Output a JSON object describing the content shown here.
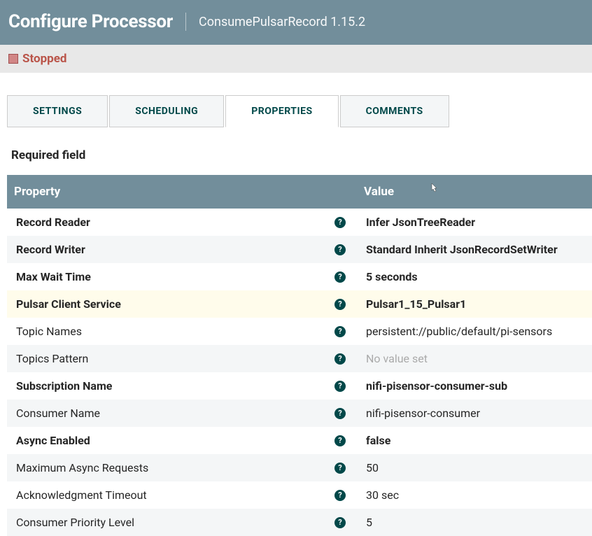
{
  "header": {
    "title": "Configure Processor",
    "subtitle": "ConsumePulsarRecord 1.15.2"
  },
  "status": {
    "label": "Stopped"
  },
  "tabs": {
    "settings": "SETTINGS",
    "scheduling": "SCHEDULING",
    "properties": "PROPERTIES",
    "comments": "COMMENTS"
  },
  "required_label": "Required field",
  "columns": {
    "property": "Property",
    "value": "Value"
  },
  "rows": [
    {
      "name": "Record Reader",
      "value": "Infer JsonTreeReader",
      "bold_name": true,
      "bold_value": true,
      "alt": false,
      "highlight": false,
      "empty": false
    },
    {
      "name": "Record Writer",
      "value": "Standard Inherit JsonRecordSetWriter",
      "bold_name": true,
      "bold_value": true,
      "alt": true,
      "highlight": false,
      "empty": false
    },
    {
      "name": "Max Wait Time",
      "value": "5 seconds",
      "bold_name": true,
      "bold_value": true,
      "alt": false,
      "highlight": false,
      "empty": false
    },
    {
      "name": "Pulsar Client Service",
      "value": "Pulsar1_15_Pulsar1",
      "bold_name": true,
      "bold_value": true,
      "alt": false,
      "highlight": true,
      "empty": false
    },
    {
      "name": "Topic Names",
      "value": "persistent://public/default/pi-sensors",
      "bold_name": false,
      "bold_value": false,
      "alt": false,
      "highlight": false,
      "empty": false
    },
    {
      "name": "Topics Pattern",
      "value": "No value set",
      "bold_name": false,
      "bold_value": false,
      "alt": true,
      "highlight": false,
      "empty": true
    },
    {
      "name": "Subscription Name",
      "value": "nifi-pisensor-consumer-sub",
      "bold_name": true,
      "bold_value": true,
      "alt": false,
      "highlight": false,
      "empty": false
    },
    {
      "name": "Consumer Name",
      "value": "nifi-pisensor-consumer",
      "bold_name": false,
      "bold_value": false,
      "alt": true,
      "highlight": false,
      "empty": false
    },
    {
      "name": "Async Enabled",
      "value": "false",
      "bold_name": true,
      "bold_value": true,
      "alt": false,
      "highlight": false,
      "empty": false
    },
    {
      "name": "Maximum Async Requests",
      "value": "50",
      "bold_name": false,
      "bold_value": false,
      "alt": true,
      "highlight": false,
      "empty": false
    },
    {
      "name": "Acknowledgment Timeout",
      "value": "30 sec",
      "bold_name": false,
      "bold_value": false,
      "alt": false,
      "highlight": false,
      "empty": false
    },
    {
      "name": "Consumer Priority Level",
      "value": "5",
      "bold_name": false,
      "bold_value": false,
      "alt": true,
      "highlight": false,
      "empty": false
    }
  ]
}
